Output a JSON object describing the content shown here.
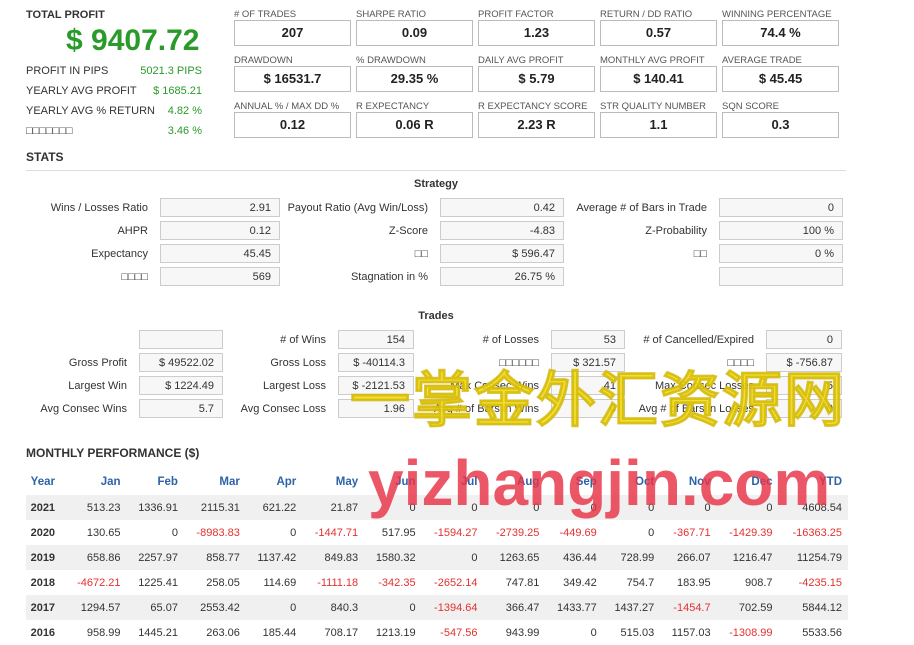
{
  "summary": {
    "total_profit_label": "TOTAL PROFIT",
    "total_profit_value": "$ 9407.72",
    "rows": [
      {
        "label": "PROFIT IN PIPS",
        "value": "5021.3 PIPS"
      },
      {
        "label": "YEARLY AVG PROFIT",
        "value": "$ 1685.21"
      },
      {
        "label": "YEARLY AVG % RETURN",
        "value": "4.82 %"
      },
      {
        "label": "□□□□□□□",
        "value": "3.46 %"
      }
    ]
  },
  "metrics": [
    {
      "label": "# OF TRADES",
      "value": "207"
    },
    {
      "label": "SHARPE RATIO",
      "value": "0.09"
    },
    {
      "label": "PROFIT FACTOR",
      "value": "1.23"
    },
    {
      "label": "RETURN / DD RATIO",
      "value": "0.57"
    },
    {
      "label": "WINNING PERCENTAGE",
      "value": "74.4 %"
    },
    {
      "label": "DRAWDOWN",
      "value": "$ 16531.7"
    },
    {
      "label": "% DRAWDOWN",
      "value": "29.35 %"
    },
    {
      "label": "DAILY AVG PROFIT",
      "value": "$ 5.79"
    },
    {
      "label": "MONTHLY AVG PROFIT",
      "value": "$ 140.41"
    },
    {
      "label": "AVERAGE TRADE",
      "value": "$ 45.45"
    },
    {
      "label": "ANNUAL % / MAX DD %",
      "value": "0.12"
    },
    {
      "label": "R EXPECTANCY",
      "value": "0.06 R"
    },
    {
      "label": "R EXPECTANCY SCORE",
      "value": "2.23 R"
    },
    {
      "label": "STR QUALITY NUMBER",
      "value": "1.1"
    },
    {
      "label": "SQN SCORE",
      "value": "0.3"
    }
  ],
  "stats": {
    "title": "STATS",
    "strategy": {
      "title": "Strategy",
      "rows": [
        [
          {
            "label": "Wins / Losses Ratio",
            "value": "2.91"
          },
          {
            "label": "Payout Ratio (Avg Win/Loss)",
            "value": "0.42"
          },
          {
            "label": "Average # of Bars in Trade",
            "value": "0"
          }
        ],
        [
          {
            "label": "AHPR",
            "value": "0.12"
          },
          {
            "label": "Z-Score",
            "value": "-4.83"
          },
          {
            "label": "Z-Probability",
            "value": "100 %"
          }
        ],
        [
          {
            "label": "Expectancy",
            "value": "45.45"
          },
          {
            "label": "□□",
            "value": "$ 596.47"
          },
          {
            "label": "□□",
            "value": "0 %"
          }
        ],
        [
          {
            "label": "□□□□",
            "value": "569"
          },
          {
            "label": "Stagnation in %",
            "value": "26.75 %"
          },
          {
            "label": "",
            "value": ""
          }
        ]
      ]
    },
    "trades": {
      "title": "Trades",
      "rows": [
        [
          {
            "label": "",
            "value": ""
          },
          {
            "label": "# of Wins",
            "value": "154"
          },
          {
            "label": "# of Losses",
            "value": "53"
          },
          {
            "label": "# of Cancelled/Expired",
            "value": "0"
          }
        ],
        [
          {
            "label": "Gross Profit",
            "value": "$ 49522.02"
          },
          {
            "label": "Gross Loss",
            "value": "$ -40114.3"
          },
          {
            "label": "□□□□□□",
            "value": "$ 321.57"
          },
          {
            "label": "□□□□",
            "value": "$ -756.87"
          }
        ],
        [
          {
            "label": "Largest Win",
            "value": "$ 1224.49"
          },
          {
            "label": "Largest Loss",
            "value": "$ -2121.53"
          },
          {
            "label": "Max Consec Wins",
            "value": "41"
          },
          {
            "label": "Max Consec Losses",
            "value": "5"
          }
        ],
        [
          {
            "label": "Avg Consec Wins",
            "value": "5.7"
          },
          {
            "label": "Avg Consec Loss",
            "value": "1.96"
          },
          {
            "label": "Avg # of Bars in Wins",
            "value": "0"
          },
          {
            "label": "Avg # of Bars in Losses",
            "value": "0"
          }
        ]
      ]
    }
  },
  "monthly": {
    "title": "MONTHLY PERFORMANCE ($)",
    "headers": [
      "Year",
      "Jan",
      "Feb",
      "Mar",
      "Apr",
      "May",
      "Jun",
      "Jul",
      "Aug",
      "Sep",
      "Oct",
      "Nov",
      "Dec",
      "YTD"
    ],
    "rows": [
      [
        "2021",
        "513.23",
        "1336.91",
        "2115.31",
        "621.22",
        "21.87",
        "0",
        "0",
        "0",
        "0",
        "0",
        "0",
        "0",
        "4608.54"
      ],
      [
        "2020",
        "130.65",
        "0",
        "-8983.83",
        "0",
        "-1447.71",
        "517.95",
        "-1594.27",
        "-2739.25",
        "-449.69",
        "0",
        "-367.71",
        "-1429.39",
        "-16363.25"
      ],
      [
        "2019",
        "658.86",
        "2257.97",
        "858.77",
        "1137.42",
        "849.83",
        "1580.32",
        "0",
        "1263.65",
        "436.44",
        "728.99",
        "266.07",
        "1216.47",
        "11254.79"
      ],
      [
        "2018",
        "-4672.21",
        "1225.41",
        "258.05",
        "114.69",
        "-1111.18",
        "-342.35",
        "-2652.14",
        "747.81",
        "349.42",
        "754.7",
        "183.95",
        "908.7",
        "-4235.15"
      ],
      [
        "2017",
        "1294.57",
        "65.07",
        "2553.42",
        "0",
        "840.3",
        "0",
        "-1394.64",
        "366.47",
        "1433.77",
        "1437.27",
        "-1454.7",
        "702.59",
        "5844.12"
      ],
      [
        "2016",
        "958.99",
        "1445.21",
        "263.06",
        "185.44",
        "708.17",
        "1213.19",
        "-547.56",
        "943.99",
        "0",
        "515.03",
        "1157.03",
        "-1308.99",
        "5533.56"
      ]
    ]
  },
  "watermark": {
    "line1": "一掌金外汇资源网",
    "line2": "yizhangjin.com"
  }
}
